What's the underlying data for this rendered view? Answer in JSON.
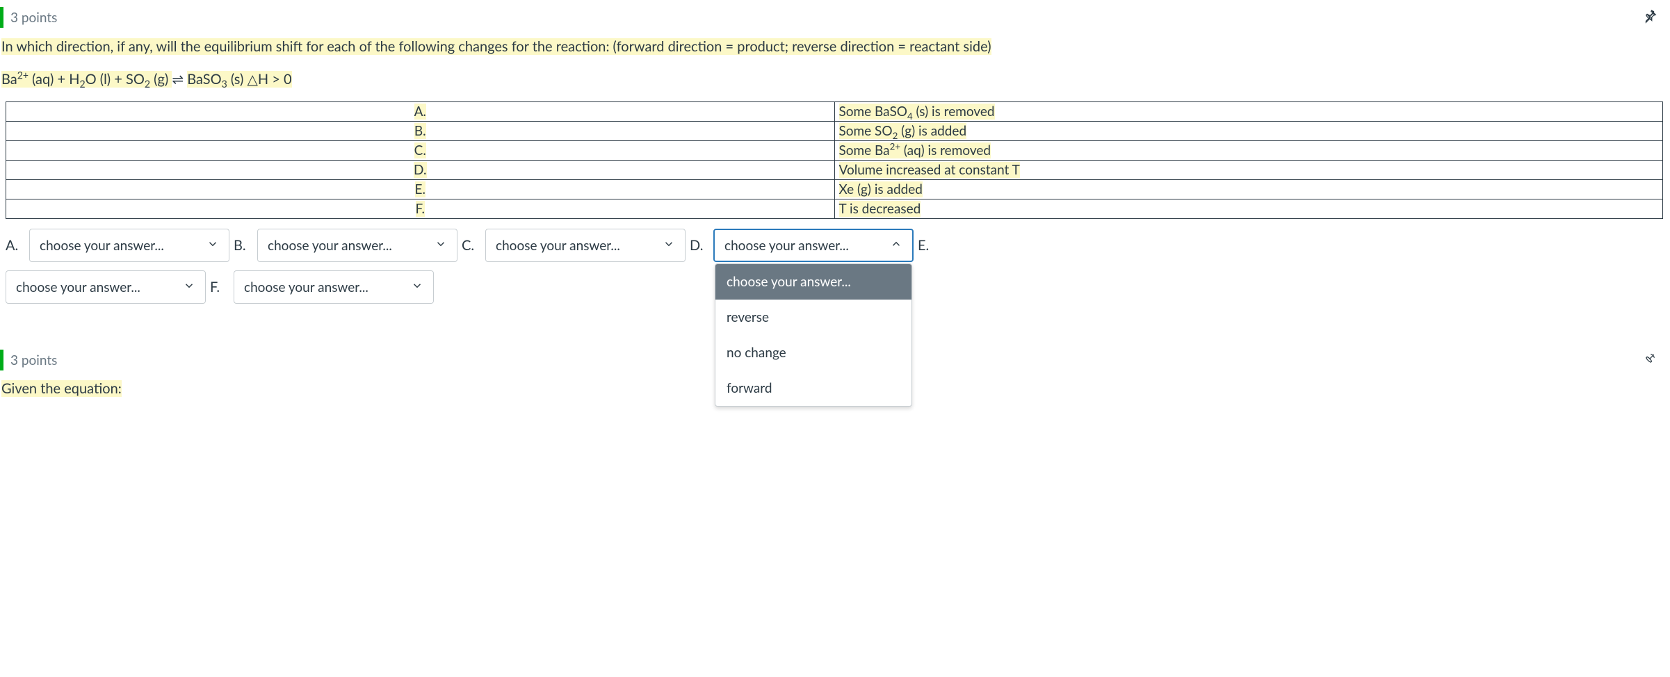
{
  "q1": {
    "points": "3 points",
    "prompt": "In which direction, if any, will the equilibrium shift for each of the following changes for the reaction: (forward direction = product; reverse direction = reactant side)",
    "equation_html": "Ba<sup>2+</sup> (aq) + H<sub>2</sub>O (l) +  SO<sub>2</sub> (g)  ⇌  BaSO<sub>3</sub> (s)  △H > 0",
    "rows": [
      {
        "label": "A.",
        "desc_html": "Some BaSO<sub>4</sub> (s) is removed"
      },
      {
        "label": "B.",
        "desc_html": "Some SO<sub>2</sub> (g) is added"
      },
      {
        "label": "C.",
        "desc_html": "Some Ba<sup>2+</sup> (aq) is removed"
      },
      {
        "label": "D.",
        "desc_html": "Volume increased at constant T"
      },
      {
        "label": "E.",
        "desc_html": "Xe (g) is added"
      },
      {
        "label": "F.",
        "desc_html": "T is decreased"
      }
    ],
    "dropdowns": {
      "placeholder": "choose your answer...",
      "labels": [
        "A.",
        "B.",
        "C.",
        "D.",
        "E.",
        "F."
      ],
      "options": [
        "choose your answer...",
        "reverse",
        "no change",
        "forward"
      ],
      "open_index": 3
    }
  },
  "q2": {
    "points": "3 points",
    "prompt": "Given the equation:"
  },
  "chart_data": {
    "type": "table",
    "rows": [
      {
        "label": "A.",
        "description": "Some BaSO4 (s) is removed"
      },
      {
        "label": "B.",
        "description": "Some SO2 (g) is added"
      },
      {
        "label": "C.",
        "description": "Some Ba2+ (aq) is removed"
      },
      {
        "label": "D.",
        "description": "Volume increased at constant T"
      },
      {
        "label": "E.",
        "description": "Xe (g) is added"
      },
      {
        "label": "F.",
        "description": "T is decreased"
      }
    ],
    "dropdown_options": [
      "choose your answer...",
      "reverse",
      "no change",
      "forward"
    ]
  }
}
